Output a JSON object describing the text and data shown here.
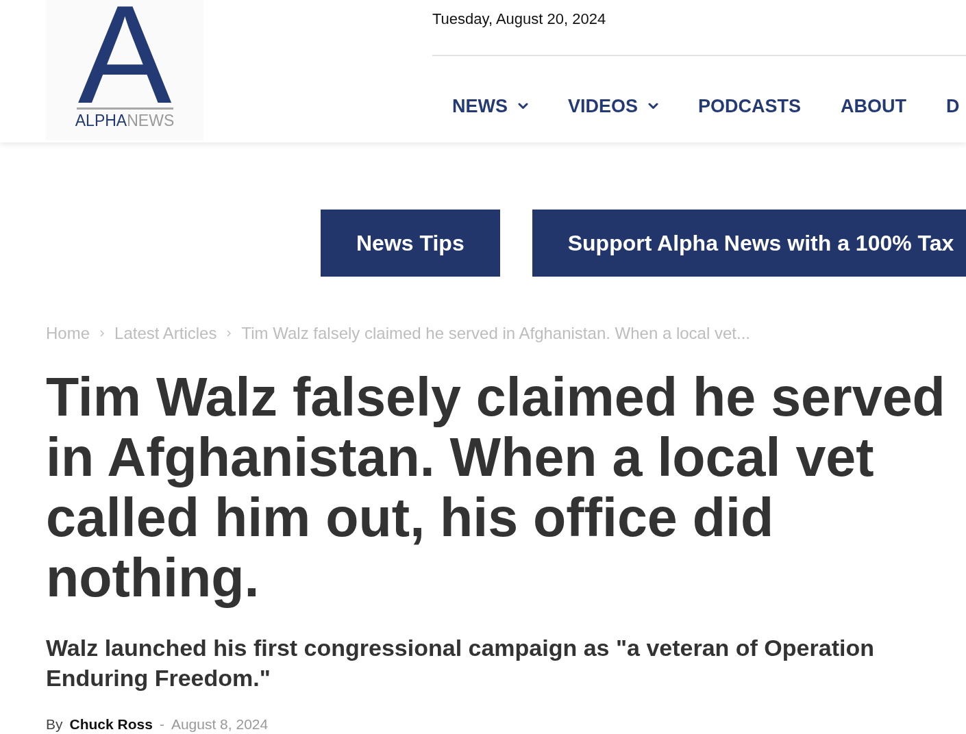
{
  "header": {
    "logo": {
      "mark": "A",
      "wordmark_dark": "ALPHA",
      "wordmark_light": "NEWS"
    },
    "date": "Tuesday, August 20, 2024",
    "nav": [
      {
        "label": "NEWS",
        "dropdown": true
      },
      {
        "label": "VIDEOS",
        "dropdown": true
      },
      {
        "label": "PODCASTS",
        "dropdown": false
      },
      {
        "label": "ABOUT",
        "dropdown": false
      },
      {
        "label": "D",
        "dropdown": false
      }
    ]
  },
  "promo_buttons": [
    "News Tips",
    "Support Alpha News with a 100% Tax"
  ],
  "breadcrumb": [
    "Home",
    "Latest Articles",
    "Tim Walz falsely claimed he served in Afghanistan. When a local vet..."
  ],
  "article": {
    "headline": "Tim Walz falsely claimed he served in Afghanistan. When a local vet called him out, his office did nothing.",
    "subtitle": "Walz launched his first congressional campaign as \"a veteran of Operation Enduring Freedom.\"",
    "byline": {
      "prefix": "By",
      "author": "Chuck Ross",
      "separator": "-",
      "date": "August 8, 2024"
    }
  }
}
